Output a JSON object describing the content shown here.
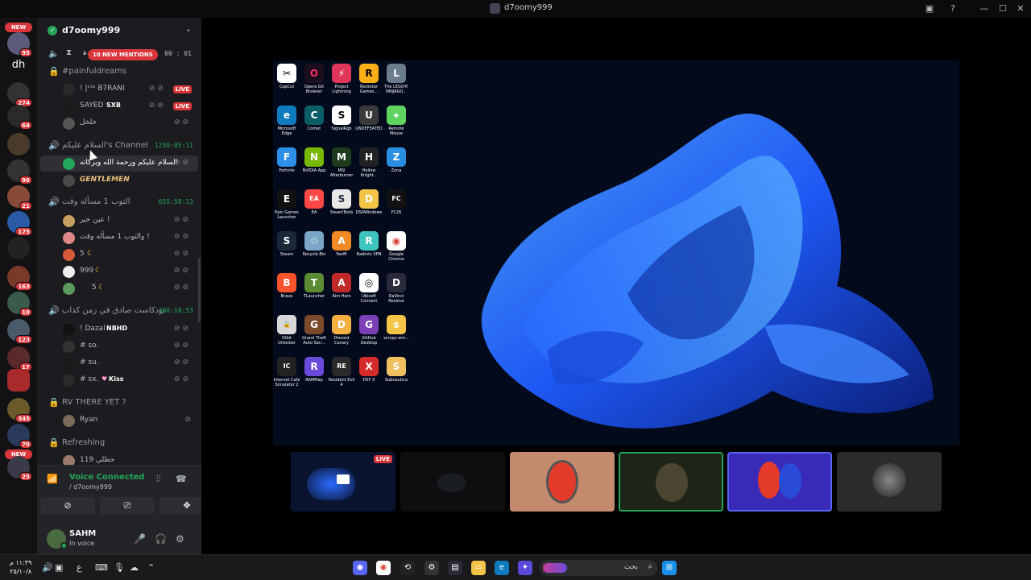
{
  "window": {
    "title": "d7oomy999"
  },
  "rail": {
    "dh_label": "dh",
    "new_label": "NEW",
    "badges": [
      "95",
      "274",
      "64",
      "96",
      "21",
      "175",
      "163",
      "10",
      "123",
      "17",
      "345",
      "70",
      "25"
    ]
  },
  "server": {
    "name": "d7oomy999"
  },
  "mentions": {
    "label": "10 NEW MENTIONS",
    "timer": "00 : 01",
    "partial": "ﻫ"
  },
  "channels": [
    {
      "name": "#painfuldreams",
      "icon": "lock-icon"
    },
    {
      "name": "السلام عليكم's Channel",
      "timer": "1250:05:11",
      "icon": "speaker-icon"
    },
    {
      "name": "التوب 1 مسأله وقت",
      "timer": "655:58:13",
      "icon": "speaker-icon"
    },
    {
      "name": "بودكاست صادق في زمن كذاب",
      "timer": "390:18:53",
      "icon": "speaker-icon"
    },
    {
      "name": "RV THERE YET ?",
      "icon": "lock-icon"
    },
    {
      "name": "Refreshing",
      "icon": "lock-icon"
    }
  ],
  "members": {
    "painfuldreams": [
      {
        "name": "! |ᵛᶦᵖ B7RANI",
        "live": "LIVE"
      },
      {
        "name": "SAYED",
        "tag": "SXB",
        "live": "LIVE"
      },
      {
        "name": "خلخل"
      }
    ],
    "salam": [
      {
        "name": "السلام عليكم ورحمة الله وبركاته"
      },
      {
        "name": "GENTLEMEN"
      }
    ],
    "toub": [
      {
        "name": "عين خير !"
      },
      {
        "name": "والتوب 1 مسأله وقت !"
      },
      {
        "name": "5"
      },
      {
        "name": "999"
      },
      {
        "name": "5"
      }
    ],
    "podcast": [
      {
        "name": "! Dazal",
        "tag": "NBHD"
      },
      {
        "name": "# so."
      },
      {
        "name": "# su."
      },
      {
        "name": "# sx.",
        "tag": "Kiss"
      }
    ],
    "rv": [
      {
        "name": "Ryan"
      }
    ],
    "refreshing": [
      {
        "name": "119 جطلي"
      }
    ]
  },
  "voice": {
    "status": "Voice Connected",
    "sub": "/ d7oomy999"
  },
  "user": {
    "name": "SAHM",
    "status": "In voice"
  },
  "desktop_icons": [
    {
      "label": "CapCut",
      "color": "#ffffff",
      "fg": "#000000",
      "glyph": "✂"
    },
    {
      "label": "Opera GX Browser",
      "color": "#1a0e1f",
      "fg": "#ff2e63",
      "glyph": "O"
    },
    {
      "label": "Project Lightning",
      "color": "#e0365a",
      "fg": "#ffffff",
      "glyph": "⚡"
    },
    {
      "label": "Rockstar Games...",
      "color": "#fcaf17",
      "fg": "#000000",
      "glyph": "R"
    },
    {
      "label": "The LEGO® NINJAGO...",
      "color": "#6b7c8c",
      "fg": "#ffffff",
      "glyph": "L"
    },
    {
      "label": "Microsoft Edge",
      "color": "#0f7bbf",
      "fg": "#ffffff",
      "glyph": "e"
    },
    {
      "label": "Comet",
      "color": "#0b5e66",
      "fg": "#ffffff",
      "glyph": "C"
    },
    {
      "label": "SignalRgb",
      "color": "#ffffff",
      "fg": "#000000",
      "glyph": "S"
    },
    {
      "label": "UNDEFEATED",
      "color": "#3a3a3a",
      "fg": "#ffffff",
      "glyph": "U"
    },
    {
      "label": "Remote Mouse",
      "color": "#5fd35f",
      "fg": "#ffffff",
      "glyph": "⌖"
    },
    {
      "label": "Fortnite",
      "color": "#2d8fe8",
      "fg": "#ffffff",
      "glyph": "F"
    },
    {
      "label": "NVIDIA App",
      "color": "#76b900",
      "fg": "#ffffff",
      "glyph": "N"
    },
    {
      "label": "MSI Afterburner",
      "color": "#1d3a1d",
      "fg": "#ffffff",
      "glyph": "M"
    },
    {
      "label": "Hollow Knight...",
      "color": "#222222",
      "fg": "#ffffff",
      "glyph": "H"
    },
    {
      "label": "Zona",
      "color": "#2a8fe0",
      "fg": "#ffffff",
      "glyph": "Z"
    },
    {
      "label": "Epic Games Launcher",
      "color": "#111111",
      "fg": "#ffffff",
      "glyph": "E"
    },
    {
      "label": "EA",
      "color": "#ff4747",
      "fg": "#ffffff",
      "glyph": "EA"
    },
    {
      "label": "SteamTools",
      "color": "#e8e8e8",
      "fg": "#1b2838",
      "glyph": "S"
    },
    {
      "label": "DS4Windows",
      "color": "#f3c447",
      "fg": "#ffffff",
      "glyph": "D"
    },
    {
      "label": "FC26",
      "color": "#111111",
      "fg": "#ffffff",
      "glyph": "FC"
    },
    {
      "label": "Steam",
      "color": "#1b2838",
      "fg": "#ffffff",
      "glyph": "S"
    },
    {
      "label": "Recycle Bin",
      "color": "#7aa7c7",
      "fg": "#ffffff",
      "glyph": "♲"
    },
    {
      "label": "FanM",
      "color": "#f08a24",
      "fg": "#ffffff",
      "glyph": "A"
    },
    {
      "label": "Radmin VPN",
      "color": "#40c4c0",
      "fg": "#ffffff",
      "glyph": "R"
    },
    {
      "label": "Google Chrome",
      "color": "#ffffff",
      "fg": "#db4437",
      "glyph": "◉"
    },
    {
      "label": "Brave",
      "color": "#fb542b",
      "fg": "#ffffff",
      "glyph": "B"
    },
    {
      "label": "TLauncher",
      "color": "#5b8b32",
      "fg": "#ffffff",
      "glyph": "T"
    },
    {
      "label": "Aim Hero",
      "color": "#c22a2a",
      "fg": "#ffffff",
      "glyph": "A"
    },
    {
      "label": "Ubisoft Connect",
      "color": "#ffffff",
      "fg": "#000000",
      "glyph": "◎"
    },
    {
      "label": "DaVinci Resolve",
      "color": "#2a2a3a",
      "fg": "#ffffff",
      "glyph": "D"
    },
    {
      "label": "IObit Unlocker",
      "color": "#d8d8d8",
      "fg": "#333333",
      "glyph": "🔒"
    },
    {
      "label": "Grand Theft Auto San...",
      "color": "#7a4a2a",
      "fg": "#ffffff",
      "glyph": "G"
    },
    {
      "label": "Discord Canary",
      "color": "#f5b041",
      "fg": "#ffffff",
      "glyph": "D"
    },
    {
      "label": "GitHub Desktop",
      "color": "#7b3fb6",
      "fg": "#ffffff",
      "glyph": "G"
    },
    {
      "label": "scrcpy-win...",
      "color": "#f3c447",
      "fg": "#ffffff",
      "glyph": "s"
    },
    {
      "label": "Internet Cafe Simulator 2",
      "color": "#222222",
      "fg": "#ffffff",
      "glyph": "IC"
    },
    {
      "label": "RAMMap",
      "color": "#6a4ad8",
      "fg": "#ffffff",
      "glyph": "R"
    },
    {
      "label": "Resident Evil 4",
      "color": "#2a2a2a",
      "fg": "#ffffff",
      "glyph": "RE"
    },
    {
      "label": "PDF X",
      "color": "#d62b2b",
      "fg": "#ffffff",
      "glyph": "X"
    },
    {
      "label": "Subnautica",
      "color": "#f0c060",
      "fg": "#ffffff",
      "glyph": "S"
    }
  ],
  "thumbnails": {
    "live_label": "LIVE"
  },
  "taskbar": {
    "time": "١١:٣٩ م",
    "date": "٢٥/١٠/٨",
    "lang": "ع",
    "search_text": "بحث"
  },
  "colors": {
    "accent": "#5865f2",
    "online": "#23a55a",
    "live": "#da373c"
  }
}
